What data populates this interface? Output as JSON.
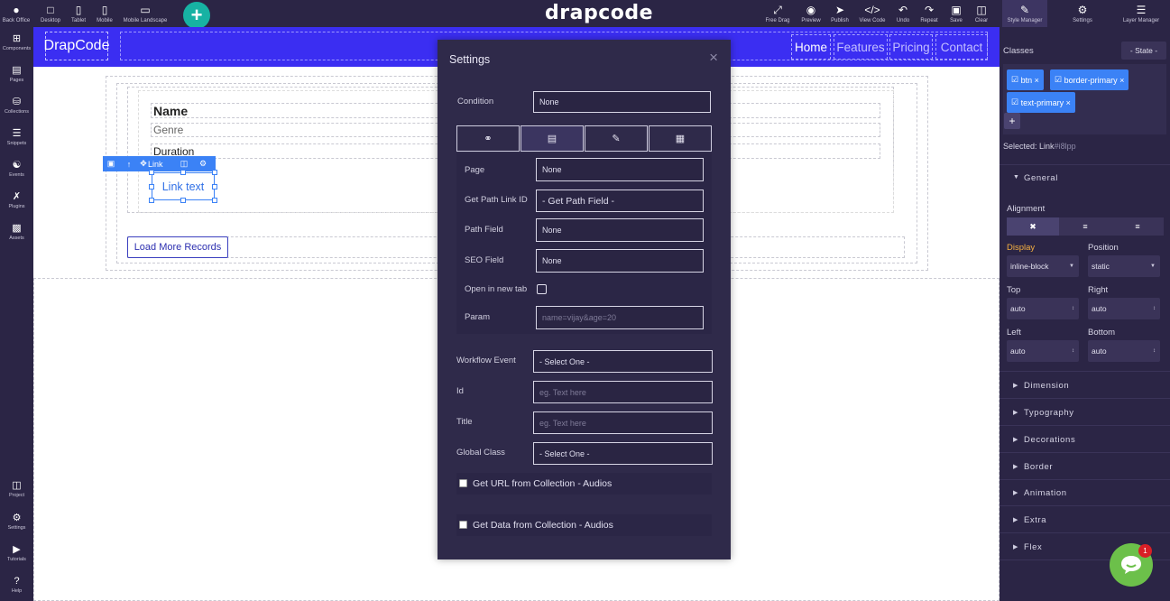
{
  "topbar": {
    "devices": [
      {
        "label": "Desktop",
        "icon": "desktop-icon"
      },
      {
        "label": "Tablet",
        "icon": "tablet-icon"
      },
      {
        "label": "Mobile",
        "icon": "mobile-icon"
      },
      {
        "label": "Mobile Landscape",
        "icon": "mobile-landscape-icon"
      }
    ],
    "logo": "drapcode",
    "tools": [
      {
        "label": "Free Drag",
        "icon": "move-icon"
      },
      {
        "label": "Preview",
        "icon": "eye-icon"
      },
      {
        "label": "Publish",
        "icon": "send-icon"
      },
      {
        "label": "View Code",
        "icon": "code-icon"
      },
      {
        "label": "Undo",
        "icon": "undo-icon"
      },
      {
        "label": "Repeat",
        "icon": "redo-icon"
      },
      {
        "label": "Save",
        "icon": "save-icon"
      },
      {
        "label": "Clear",
        "icon": "trash-icon"
      }
    ],
    "panels": [
      {
        "label": "Style Manager",
        "icon": "brush-icon"
      },
      {
        "label": "Settings",
        "icon": "gear-icon"
      },
      {
        "label": "Layer Manager",
        "icon": "layers-icon"
      }
    ]
  },
  "sidebar": {
    "top": [
      {
        "label": "Back Office",
        "icon": "user-icon"
      },
      {
        "label": "Components",
        "icon": "plus-square-icon"
      },
      {
        "label": "Pages",
        "icon": "pages-icon"
      },
      {
        "label": "Collections",
        "icon": "database-icon"
      },
      {
        "label": "Snippets",
        "icon": "list-icon"
      },
      {
        "label": "Events",
        "icon": "events-icon"
      },
      {
        "label": "Plugins",
        "icon": "tools-icon"
      },
      {
        "label": "Assets",
        "icon": "image-icon"
      }
    ],
    "bottom": [
      {
        "label": "Project",
        "icon": "project-icon"
      },
      {
        "label": "Settings",
        "icon": "cogs-icon"
      },
      {
        "label": "Tutorials",
        "icon": "youtube-icon"
      },
      {
        "label": "Help",
        "icon": "help-icon"
      }
    ]
  },
  "canvas": {
    "brand": "DrapCode",
    "nav": [
      "Home",
      "Features",
      "Pricing",
      "Contact"
    ],
    "fields": [
      "Name",
      "Genre",
      "Duration"
    ],
    "toolbar_label": "Link",
    "link_text": "Link text",
    "load_more": "Load More Records"
  },
  "modal": {
    "title": "Settings",
    "close": "×",
    "condition_label": "Condition",
    "condition_value": "None",
    "page_label": "Page",
    "page_value": "None",
    "path_link_id_label": "Get Path Link ID",
    "path_link_id_value": "- Get Path Field -",
    "path_field_label": "Path Field",
    "path_field_value": "None",
    "seo_field_label": "SEO Field",
    "seo_field_value": "None",
    "new_tab_label": "Open in new tab",
    "param_label": "Param",
    "param_placeholder": "name=vijay&age=20",
    "workflow_label": "Workflow Event",
    "workflow_value": "- Select One -",
    "id_label": "Id",
    "id_placeholder": "eg. Text here",
    "title_label": "Title",
    "title_placeholder": "eg. Text here",
    "global_class_label": "Global Class",
    "global_class_value": "- Select One -",
    "url_collection": "Get URL from Collection - Audios",
    "data_collection": "Get Data from Collection - Audios"
  },
  "right_panel": {
    "classes_label": "Classes",
    "state": "- State -",
    "tags": [
      "btn",
      "border-primary",
      "text-primary"
    ],
    "selected_label": "Selected:",
    "selected_value": "Link",
    "selected_id": "#i8lpp",
    "general": "General",
    "alignment": "Alignment",
    "display_label": "Display",
    "display_value": "inline-block",
    "position_label": "Position",
    "position_value": "static",
    "top_label": "Top",
    "top_value": "auto",
    "right_label": "Right",
    "right_value": "auto",
    "left_label": "Left",
    "left_value": "auto",
    "bottom_label": "Bottom",
    "bottom_value": "auto",
    "sections": [
      "Dimension",
      "Typography",
      "Decorations",
      "Border",
      "Animation",
      "Extra",
      "Flex"
    ],
    "display_color": "#f5b041"
  },
  "chat": {
    "badge": "1"
  }
}
